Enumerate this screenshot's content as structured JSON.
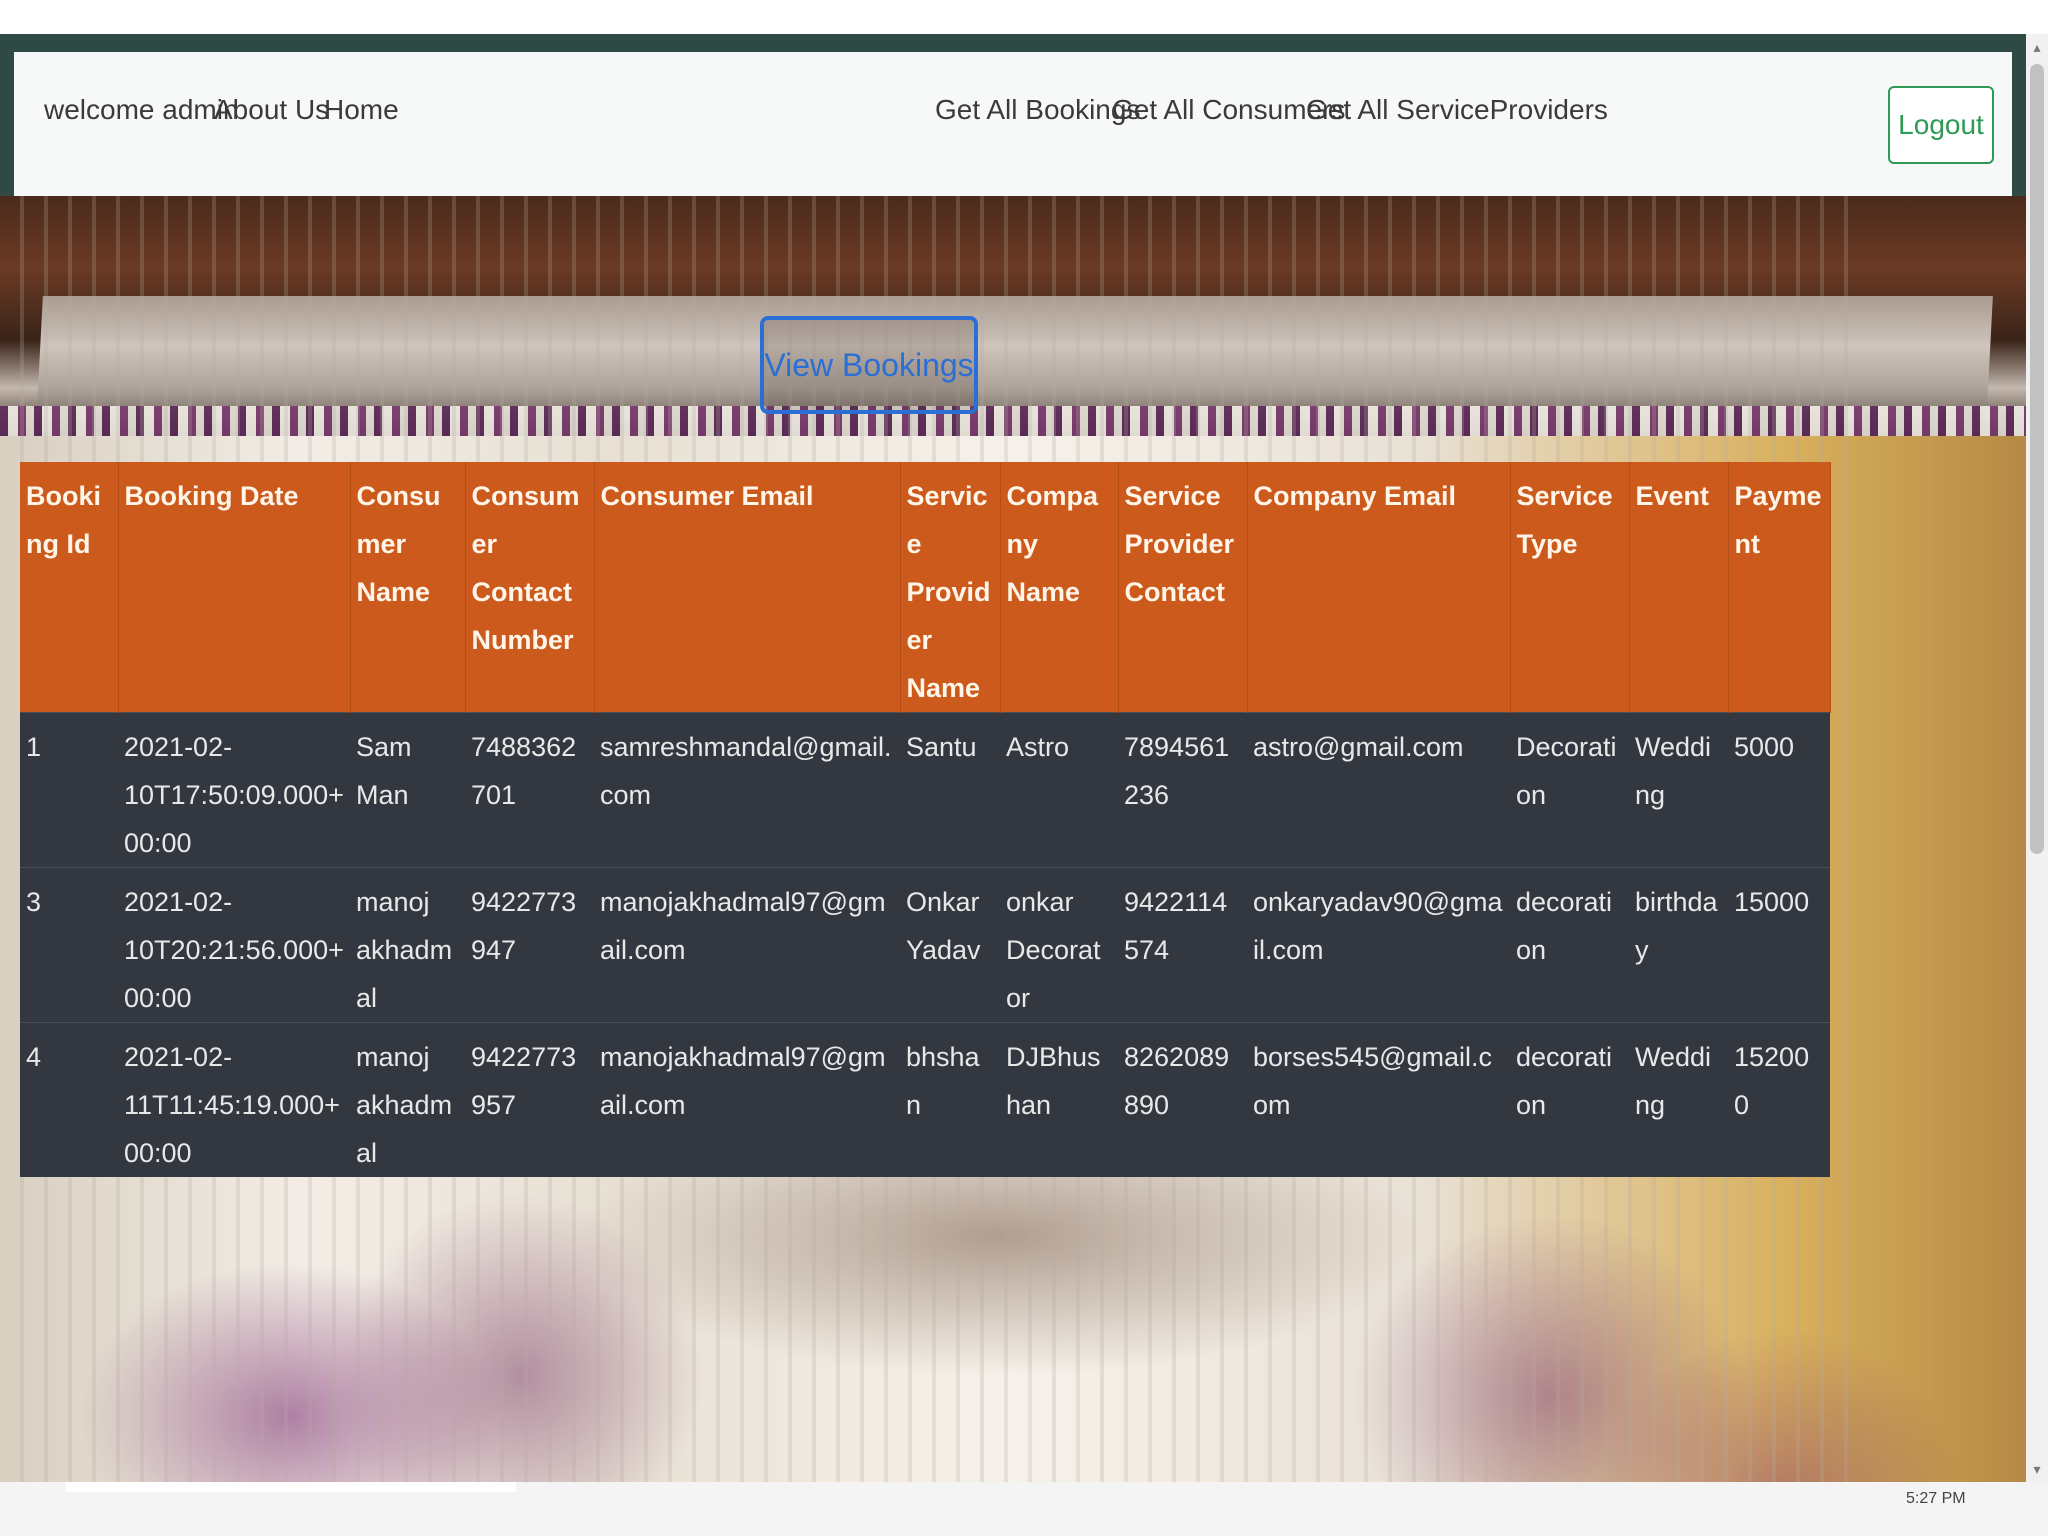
{
  "navbar": {
    "welcome": "welcome admin",
    "about": "About Us",
    "home": "Home",
    "get_bookings": "Get All Bookings",
    "get_consumers": "Get All Consumers",
    "get_providers": "Get All ServiceProviders",
    "logout": "Logout"
  },
  "view_bookings_label": "View Bookings",
  "table": {
    "headers": [
      "Booking Id",
      "Booking Date",
      "Consumer Name",
      "Consumer Contact Number",
      "Consumer Email",
      "Service Provider Name",
      "Company Name",
      "Service Provider Contact",
      "Company Email",
      "Service Type",
      "Event",
      "Payment"
    ],
    "rows": [
      [
        "1",
        "2021-02-10T17:50:09.000+00:00",
        "Sam Man",
        "7488362701",
        "samreshmandal@gmail.com",
        "Santu",
        "Astro",
        "7894561236",
        "astro@gmail.com",
        "Decoration",
        "Wedding",
        "5000"
      ],
      [
        "3",
        "2021-02-10T20:21:56.000+00:00",
        "manoj akhadmal",
        "9422773947",
        "manojakhadmal97@gmail.com",
        "Onkar Yadav",
        "onkar Decorator",
        "9422114574",
        "onkaryadav90@gmail.com",
        "decoration",
        "birthday",
        "15000"
      ],
      [
        "4",
        "2021-02-11T11:45:19.000+00:00",
        "manoj akhadmal",
        "9422773957",
        "manojakhadmal97@gmail.com",
        "bhshan",
        "DJBhushan",
        "8262089890",
        "borses545@gmail.com",
        "decoration",
        "Wedding",
        "152000"
      ]
    ]
  },
  "taskbar": {
    "clock": "5:27 PM"
  },
  "colors": {
    "header_bg": "#cc5a1d",
    "row_bg": "#333840",
    "frame": "#2f4a44",
    "logout_green": "#2e9a55",
    "view_btn_blue": "#2a6fd6"
  }
}
